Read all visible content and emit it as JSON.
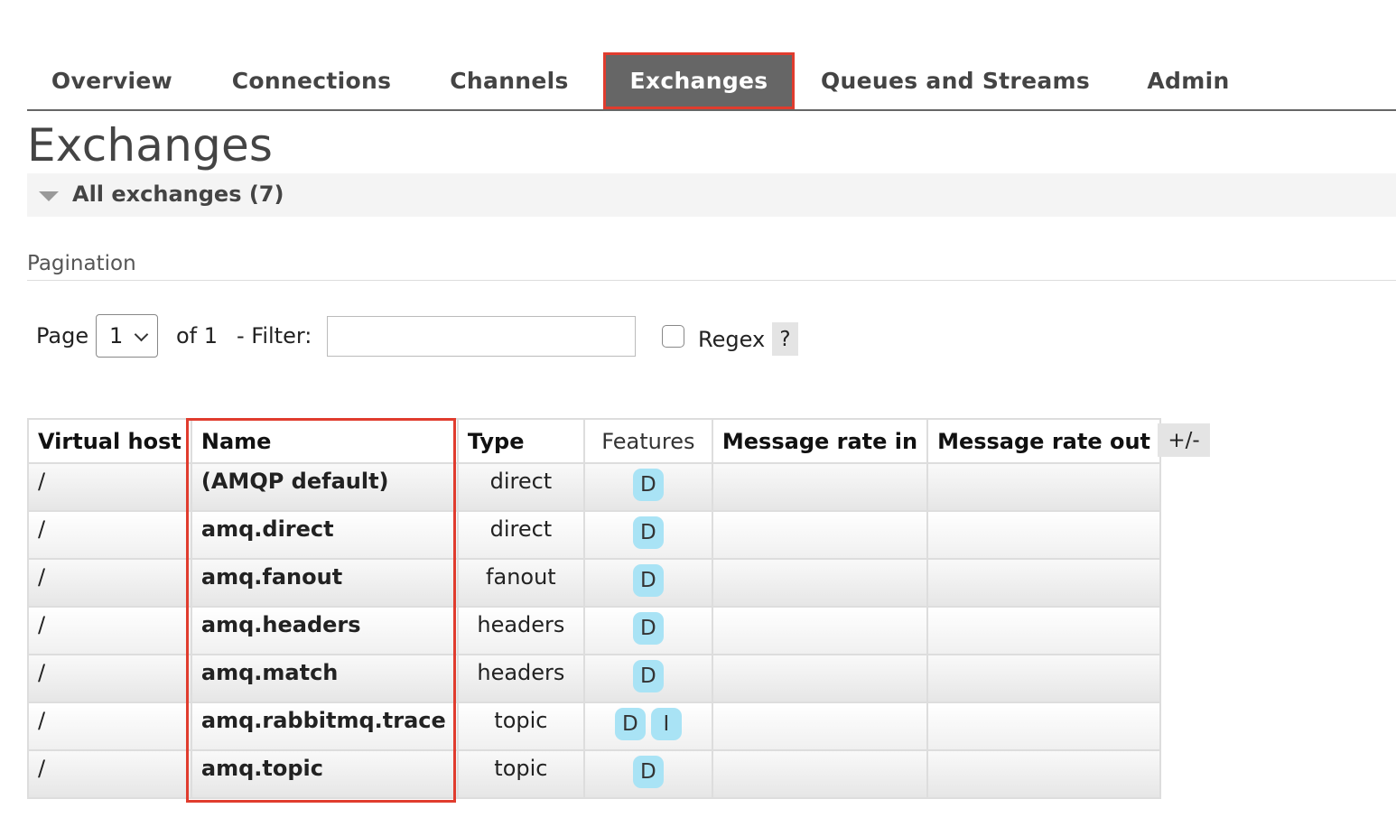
{
  "nav": {
    "tabs": [
      {
        "label": "Overview"
      },
      {
        "label": "Connections"
      },
      {
        "label": "Channels"
      },
      {
        "label": "Exchanges",
        "active": true
      },
      {
        "label": "Queues and Streams"
      },
      {
        "label": "Admin"
      }
    ]
  },
  "page": {
    "title": "Exchanges",
    "section_title": "All exchanges (7)",
    "pagination_label": "Pagination"
  },
  "filter": {
    "page_label": "Page",
    "page_value": "1",
    "of_label": "of 1",
    "filter_label": "- Filter:",
    "filter_value": "",
    "regex_label": "Regex",
    "regex_checked": false,
    "help_label": "?"
  },
  "table": {
    "columns": [
      "Virtual host",
      "Name",
      "Type",
      "Features",
      "Message rate in",
      "Message rate out"
    ],
    "toggle_label": "+/-",
    "rows": [
      {
        "vhost": "/",
        "name": "(AMQP default)",
        "type": "direct",
        "features": [
          "D"
        ],
        "rate_in": "",
        "rate_out": ""
      },
      {
        "vhost": "/",
        "name": "amq.direct",
        "type": "direct",
        "features": [
          "D"
        ],
        "rate_in": "",
        "rate_out": ""
      },
      {
        "vhost": "/",
        "name": "amq.fanout",
        "type": "fanout",
        "features": [
          "D"
        ],
        "rate_in": "",
        "rate_out": ""
      },
      {
        "vhost": "/",
        "name": "amq.headers",
        "type": "headers",
        "features": [
          "D"
        ],
        "rate_in": "",
        "rate_out": ""
      },
      {
        "vhost": "/",
        "name": "amq.match",
        "type": "headers",
        "features": [
          "D"
        ],
        "rate_in": "",
        "rate_out": ""
      },
      {
        "vhost": "/",
        "name": "amq.rabbitmq.trace",
        "type": "topic",
        "features": [
          "D",
          "I"
        ],
        "rate_in": "",
        "rate_out": ""
      },
      {
        "vhost": "/",
        "name": "amq.topic",
        "type": "topic",
        "features": [
          "D"
        ],
        "rate_in": "",
        "rate_out": ""
      }
    ]
  },
  "colors": {
    "active_tab_bg": "#666666",
    "highlight_border": "#e03c2e",
    "badge_bg": "#a9e3f5"
  }
}
